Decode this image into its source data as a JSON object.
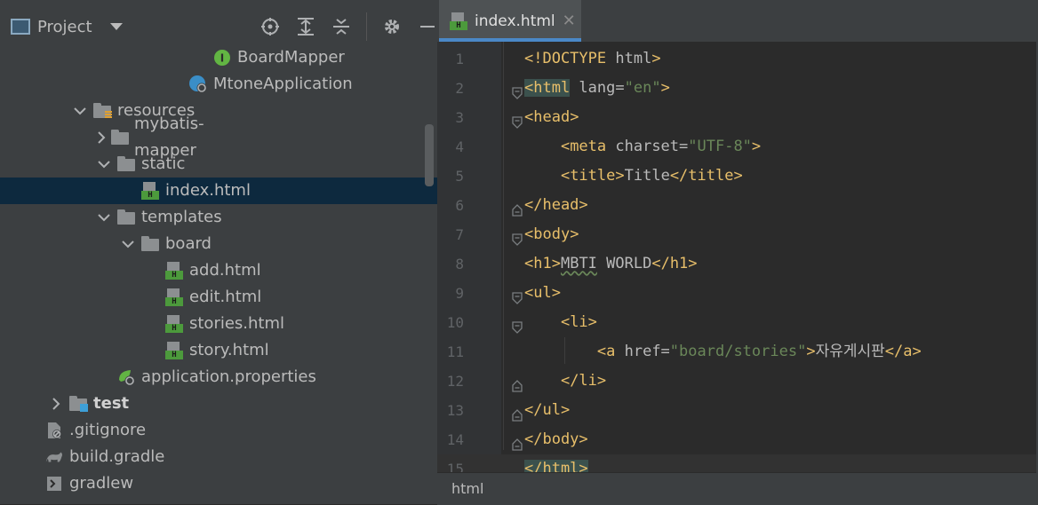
{
  "project_panel": {
    "title": "Project",
    "tree": [
      {
        "label": "BoardMapper",
        "icon": "interface-icon",
        "indent": 245,
        "selected": false,
        "bold": false,
        "arrow": ""
      },
      {
        "label": "MtoneApplication",
        "icon": "spring-app-icon",
        "indent": 218,
        "selected": false,
        "bold": false,
        "arrow": ""
      },
      {
        "label": "resources",
        "icon": "resources-folder-icon",
        "indent": 110,
        "selected": false,
        "bold": false,
        "arrow": "down"
      },
      {
        "label": "mybatis-mapper",
        "icon": "folder-icon",
        "indent": 137,
        "selected": false,
        "bold": false,
        "arrow": "right"
      },
      {
        "label": "static",
        "icon": "folder-icon",
        "indent": 137,
        "selected": false,
        "bold": false,
        "arrow": "down"
      },
      {
        "label": "index.html",
        "icon": "html-file-icon",
        "indent": 164,
        "selected": true,
        "bold": false,
        "arrow": ""
      },
      {
        "label": "templates",
        "icon": "folder-icon",
        "indent": 137,
        "selected": false,
        "bold": false,
        "arrow": "down"
      },
      {
        "label": "board",
        "icon": "folder-icon",
        "indent": 164,
        "selected": false,
        "bold": false,
        "arrow": "down"
      },
      {
        "label": "add.html",
        "icon": "html-file-icon",
        "indent": 191,
        "selected": false,
        "bold": false,
        "arrow": ""
      },
      {
        "label": "edit.html",
        "icon": "html-file-icon",
        "indent": 191,
        "selected": false,
        "bold": false,
        "arrow": ""
      },
      {
        "label": "stories.html",
        "icon": "html-file-icon",
        "indent": 191,
        "selected": false,
        "bold": false,
        "arrow": ""
      },
      {
        "label": "story.html",
        "icon": "html-file-icon",
        "indent": 191,
        "selected": false,
        "bold": false,
        "arrow": ""
      },
      {
        "label": "application.properties",
        "icon": "properties-file-icon",
        "indent": 137,
        "selected": false,
        "bold": false,
        "arrow": ""
      },
      {
        "label": "test",
        "icon": "test-folder-icon",
        "indent": 83,
        "selected": false,
        "bold": true,
        "arrow": "right"
      },
      {
        "label": ".gitignore",
        "icon": "gitignore-file-icon",
        "indent": 56,
        "selected": false,
        "bold": false,
        "arrow": ""
      },
      {
        "label": "build.gradle",
        "icon": "gradle-icon",
        "indent": 56,
        "selected": false,
        "bold": false,
        "arrow": ""
      },
      {
        "label": "gradlew",
        "icon": "terminal-file-icon",
        "indent": 56,
        "selected": false,
        "bold": false,
        "arrow": ""
      }
    ]
  },
  "editor": {
    "tab_label": "index.html",
    "tab_close": "✕",
    "status_text": "html",
    "lines": [
      {
        "n": "1",
        "text": "<!DOCTYPE html>"
      },
      {
        "n": "2",
        "text": "<html lang=\"en\">"
      },
      {
        "n": "3",
        "text": "<head>"
      },
      {
        "n": "4",
        "text": "    <meta charset=\"UTF-8\">"
      },
      {
        "n": "5",
        "text": "    <title>Title</title>"
      },
      {
        "n": "6",
        "text": "</head>"
      },
      {
        "n": "7",
        "text": "<body>"
      },
      {
        "n": "8",
        "text": "<h1>MBTI WORLD</h1>"
      },
      {
        "n": "9",
        "text": "<ul>"
      },
      {
        "n": "10",
        "text": "    <li>"
      },
      {
        "n": "11",
        "text": "        <a href=\"board/stories\">자유게시판</a>"
      },
      {
        "n": "12",
        "text": "    </li>"
      },
      {
        "n": "13",
        "text": "</ul>"
      },
      {
        "n": "14",
        "text": "</body>"
      },
      {
        "n": "15",
        "text": "</html>"
      }
    ]
  },
  "colors": {
    "tag": "#e8bf6a",
    "string": "#6a8759",
    "text": "#bababa",
    "selection": "#0d293e",
    "tab_accent": "#4a88c7"
  }
}
